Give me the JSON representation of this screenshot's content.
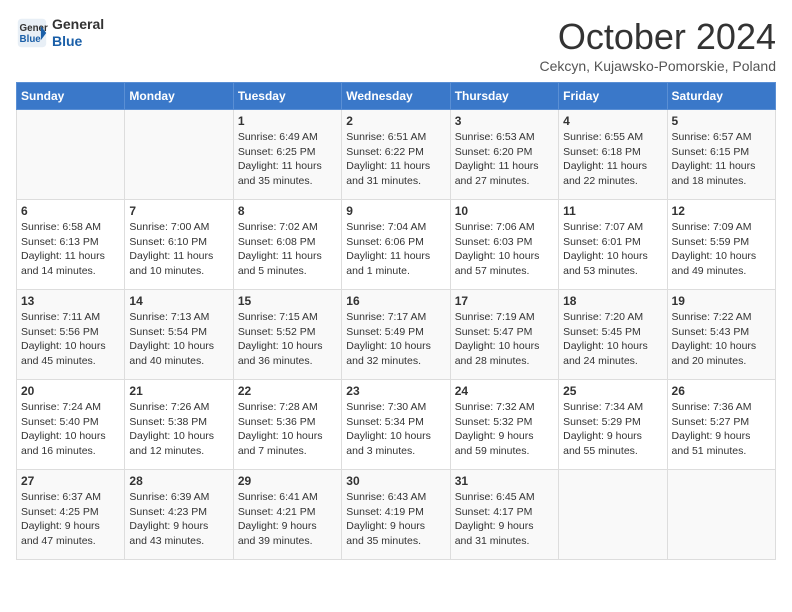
{
  "header": {
    "logo_line1": "General",
    "logo_line2": "Blue",
    "title": "October 2024",
    "subtitle": "Cekcyn, Kujawsko-Pomorskie, Poland"
  },
  "weekdays": [
    "Sunday",
    "Monday",
    "Tuesday",
    "Wednesday",
    "Thursday",
    "Friday",
    "Saturday"
  ],
  "weeks": [
    [
      {
        "day": "",
        "content": ""
      },
      {
        "day": "",
        "content": ""
      },
      {
        "day": "1",
        "content": "Sunrise: 6:49 AM\nSunset: 6:25 PM\nDaylight: 11 hours\nand 35 minutes."
      },
      {
        "day": "2",
        "content": "Sunrise: 6:51 AM\nSunset: 6:22 PM\nDaylight: 11 hours\nand 31 minutes."
      },
      {
        "day": "3",
        "content": "Sunrise: 6:53 AM\nSunset: 6:20 PM\nDaylight: 11 hours\nand 27 minutes."
      },
      {
        "day": "4",
        "content": "Sunrise: 6:55 AM\nSunset: 6:18 PM\nDaylight: 11 hours\nand 22 minutes."
      },
      {
        "day": "5",
        "content": "Sunrise: 6:57 AM\nSunset: 6:15 PM\nDaylight: 11 hours\nand 18 minutes."
      }
    ],
    [
      {
        "day": "6",
        "content": "Sunrise: 6:58 AM\nSunset: 6:13 PM\nDaylight: 11 hours\nand 14 minutes."
      },
      {
        "day": "7",
        "content": "Sunrise: 7:00 AM\nSunset: 6:10 PM\nDaylight: 11 hours\nand 10 minutes."
      },
      {
        "day": "8",
        "content": "Sunrise: 7:02 AM\nSunset: 6:08 PM\nDaylight: 11 hours\nand 5 minutes."
      },
      {
        "day": "9",
        "content": "Sunrise: 7:04 AM\nSunset: 6:06 PM\nDaylight: 11 hours\nand 1 minute."
      },
      {
        "day": "10",
        "content": "Sunrise: 7:06 AM\nSunset: 6:03 PM\nDaylight: 10 hours\nand 57 minutes."
      },
      {
        "day": "11",
        "content": "Sunrise: 7:07 AM\nSunset: 6:01 PM\nDaylight: 10 hours\nand 53 minutes."
      },
      {
        "day": "12",
        "content": "Sunrise: 7:09 AM\nSunset: 5:59 PM\nDaylight: 10 hours\nand 49 minutes."
      }
    ],
    [
      {
        "day": "13",
        "content": "Sunrise: 7:11 AM\nSunset: 5:56 PM\nDaylight: 10 hours\nand 45 minutes."
      },
      {
        "day": "14",
        "content": "Sunrise: 7:13 AM\nSunset: 5:54 PM\nDaylight: 10 hours\nand 40 minutes."
      },
      {
        "day": "15",
        "content": "Sunrise: 7:15 AM\nSunset: 5:52 PM\nDaylight: 10 hours\nand 36 minutes."
      },
      {
        "day": "16",
        "content": "Sunrise: 7:17 AM\nSunset: 5:49 PM\nDaylight: 10 hours\nand 32 minutes."
      },
      {
        "day": "17",
        "content": "Sunrise: 7:19 AM\nSunset: 5:47 PM\nDaylight: 10 hours\nand 28 minutes."
      },
      {
        "day": "18",
        "content": "Sunrise: 7:20 AM\nSunset: 5:45 PM\nDaylight: 10 hours\nand 24 minutes."
      },
      {
        "day": "19",
        "content": "Sunrise: 7:22 AM\nSunset: 5:43 PM\nDaylight: 10 hours\nand 20 minutes."
      }
    ],
    [
      {
        "day": "20",
        "content": "Sunrise: 7:24 AM\nSunset: 5:40 PM\nDaylight: 10 hours\nand 16 minutes."
      },
      {
        "day": "21",
        "content": "Sunrise: 7:26 AM\nSunset: 5:38 PM\nDaylight: 10 hours\nand 12 minutes."
      },
      {
        "day": "22",
        "content": "Sunrise: 7:28 AM\nSunset: 5:36 PM\nDaylight: 10 hours\nand 7 minutes."
      },
      {
        "day": "23",
        "content": "Sunrise: 7:30 AM\nSunset: 5:34 PM\nDaylight: 10 hours\nand 3 minutes."
      },
      {
        "day": "24",
        "content": "Sunrise: 7:32 AM\nSunset: 5:32 PM\nDaylight: 9 hours\nand 59 minutes."
      },
      {
        "day": "25",
        "content": "Sunrise: 7:34 AM\nSunset: 5:29 PM\nDaylight: 9 hours\nand 55 minutes."
      },
      {
        "day": "26",
        "content": "Sunrise: 7:36 AM\nSunset: 5:27 PM\nDaylight: 9 hours\nand 51 minutes."
      }
    ],
    [
      {
        "day": "27",
        "content": "Sunrise: 6:37 AM\nSunset: 4:25 PM\nDaylight: 9 hours\nand 47 minutes."
      },
      {
        "day": "28",
        "content": "Sunrise: 6:39 AM\nSunset: 4:23 PM\nDaylight: 9 hours\nand 43 minutes."
      },
      {
        "day": "29",
        "content": "Sunrise: 6:41 AM\nSunset: 4:21 PM\nDaylight: 9 hours\nand 39 minutes."
      },
      {
        "day": "30",
        "content": "Sunrise: 6:43 AM\nSunset: 4:19 PM\nDaylight: 9 hours\nand 35 minutes."
      },
      {
        "day": "31",
        "content": "Sunrise: 6:45 AM\nSunset: 4:17 PM\nDaylight: 9 hours\nand 31 minutes."
      },
      {
        "day": "",
        "content": ""
      },
      {
        "day": "",
        "content": ""
      }
    ]
  ]
}
